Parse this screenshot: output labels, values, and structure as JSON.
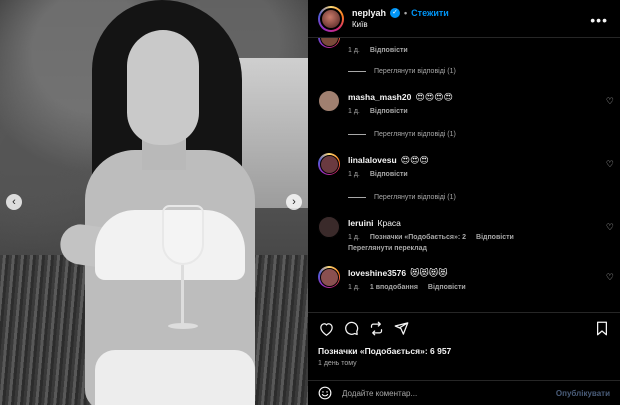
{
  "post": {
    "username": "neplyah",
    "follow_label": "Стежити",
    "location": "Київ",
    "likes_label": "Позначки «Подобається»: 6 957",
    "time_label": "1 день тому"
  },
  "comments": [
    {
      "username": "",
      "text": "",
      "time": "1 д.",
      "reply_label": "Відповісти",
      "replies_label": "Переглянути відповіді (1)"
    },
    {
      "username": "masha_mash20",
      "text": "😍😍😍😍",
      "time": "1 д.",
      "reply_label": "Відповісти",
      "replies_label": "Переглянути відповіді (1)"
    },
    {
      "username": "linalalovesu",
      "text": "😍😍😍",
      "time": "1 д.",
      "reply_label": "Відповісти",
      "replies_label": "Переглянути відповіді (1)"
    },
    {
      "username": "leruini",
      "text": "Краса",
      "time": "1 д.",
      "likes_label": "Позначки «Подобається»: 2",
      "reply_label": "Відповісти",
      "translate_label": "Переглянути переклад"
    },
    {
      "username": "loveshine3576",
      "text": "😻😻😻😻",
      "time": "1 д.",
      "likes_label": "1 вподобання",
      "reply_label": "Відповісти"
    }
  ],
  "composer": {
    "placeholder": "Додайте коментар...",
    "publish_label": "Опублікувати"
  },
  "icons": {
    "like": "heart-icon",
    "comment": "comment-icon",
    "share": "repost-icon",
    "send": "send-icon",
    "save": "bookmark-icon",
    "emoji": "smile-icon"
  }
}
